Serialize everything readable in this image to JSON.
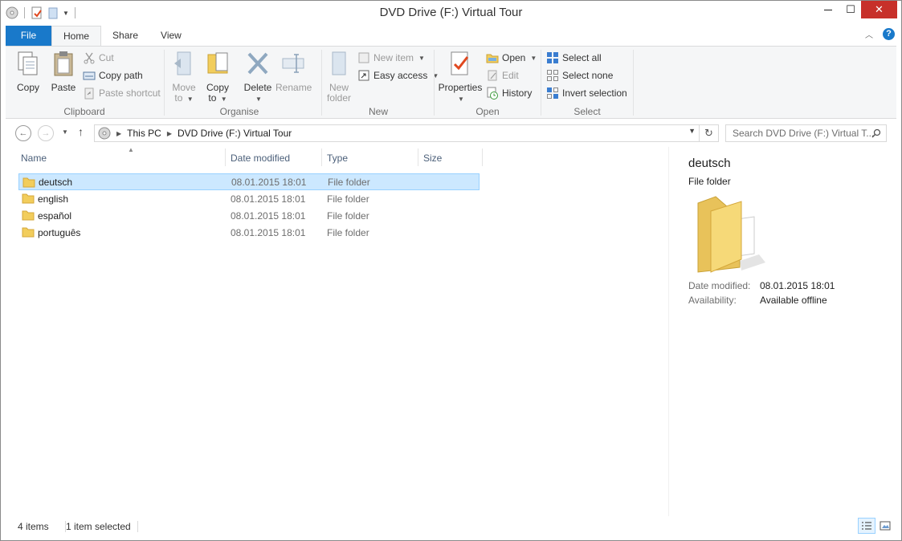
{
  "window": {
    "title": "DVD Drive (F:) Virtual Tour",
    "close_glyph": "✕",
    "minimize_glyph": "—",
    "maximize_glyph": "☐"
  },
  "ribbon": {
    "tabs": [
      {
        "label": "File"
      },
      {
        "label": "Home"
      },
      {
        "label": "Share"
      },
      {
        "label": "View"
      }
    ],
    "help_label": "?",
    "groups": {
      "clipboard": {
        "label": "Clipboard",
        "copy": "Copy",
        "paste": "Paste",
        "cut": "Cut",
        "copy_path": "Copy path",
        "paste_shortcut": "Paste shortcut"
      },
      "organise": {
        "label": "Organise",
        "move_to_1": "Move",
        "move_to_2": "to",
        "copy_to_1": "Copy",
        "copy_to_2": "to",
        "delete": "Delete",
        "rename": "Rename"
      },
      "new": {
        "label": "New",
        "new_folder_1": "New",
        "new_folder_2": "folder",
        "new_item": "New item",
        "easy_access": "Easy access"
      },
      "open": {
        "label": "Open",
        "properties": "Properties",
        "open": "Open",
        "edit": "Edit",
        "history": "History"
      },
      "select": {
        "label": "Select",
        "select_all": "Select all",
        "select_none": "Select none",
        "invert_selection": "Invert selection"
      }
    }
  },
  "address": {
    "crumbs": [
      "This PC",
      "DVD Drive (F:) Virtual Tour"
    ],
    "search_placeholder": "Search DVD Drive (F:) Virtual T..."
  },
  "columns": [
    "Name",
    "Date modified",
    "Type",
    "Size"
  ],
  "files": [
    {
      "name": "deutsch",
      "date": "08.01.2015 18:01",
      "type": "File folder"
    },
    {
      "name": "english",
      "date": "08.01.2015 18:01",
      "type": "File folder"
    },
    {
      "name": "español",
      "date": "08.01.2015 18:01",
      "type": "File folder"
    },
    {
      "name": "português",
      "date": "08.01.2015 18:01",
      "type": "File folder"
    }
  ],
  "details": {
    "name": "deutsch",
    "kind": "File folder",
    "date_label": "Date modified:",
    "date_value": "08.01.2015 18:01",
    "avail_label": "Availability:",
    "avail_value": "Available offline"
  },
  "status": {
    "items": "4 items",
    "selected": "1 item selected"
  },
  "colors": {
    "accent": "#1979ca",
    "selection": "#cce8ff",
    "close": "#c7302a"
  }
}
